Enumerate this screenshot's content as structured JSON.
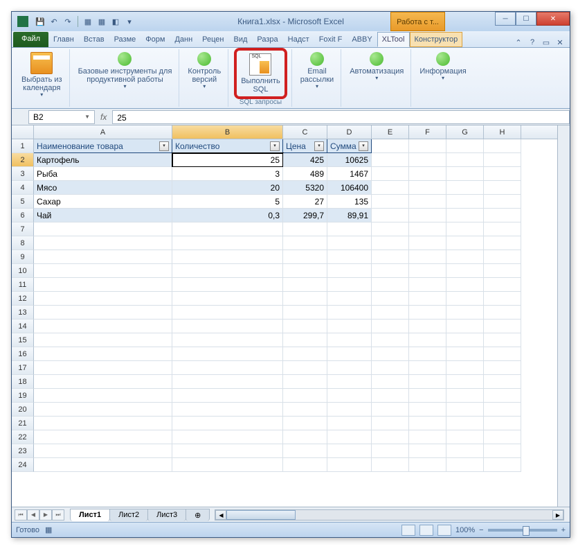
{
  "title": "Книга1.xlsx - Microsoft Excel",
  "tool_tab": "Работа с т...",
  "tabs": {
    "file": "Файл",
    "items": [
      "Главн",
      "Встав",
      "Разме",
      "Форм",
      "Данн",
      "Рецен",
      "Вид",
      "Разра",
      "Надст",
      "Foxit F",
      "ABBY",
      "XLTool"
    ],
    "constructor": "Конструктор",
    "active": "XLTool"
  },
  "ribbon": {
    "calendar": "Выбрать из\nкалендаря",
    "tools": "Базовые инструменты для\nпродуктивной работы",
    "versions": "Контроль\nверсий",
    "sql": "Выполнить\nSQL",
    "sql_group": "SQL запросы",
    "email": "Email\nрассылки",
    "auto": "Автоматизация",
    "info": "Информация"
  },
  "namebox": "B2",
  "formula": "25",
  "headers": [
    "Наименование товара",
    "Количество",
    "Цена",
    "Сумма"
  ],
  "rows": [
    {
      "name": "Картофель",
      "qty": "25",
      "price": "425",
      "sum": "10625"
    },
    {
      "name": "Рыба",
      "qty": "3",
      "price": "489",
      "sum": "1467"
    },
    {
      "name": "Мясо",
      "qty": "20",
      "price": "5320",
      "sum": "106400"
    },
    {
      "name": "Сахар",
      "qty": "5",
      "price": "27",
      "sum": "135"
    },
    {
      "name": "Чай",
      "qty": "0,3",
      "price": "299,7",
      "sum": "89,91"
    }
  ],
  "sheets": [
    "Лист1",
    "Лист2",
    "Лист3"
  ],
  "status": "Готово",
  "zoom": "100%"
}
